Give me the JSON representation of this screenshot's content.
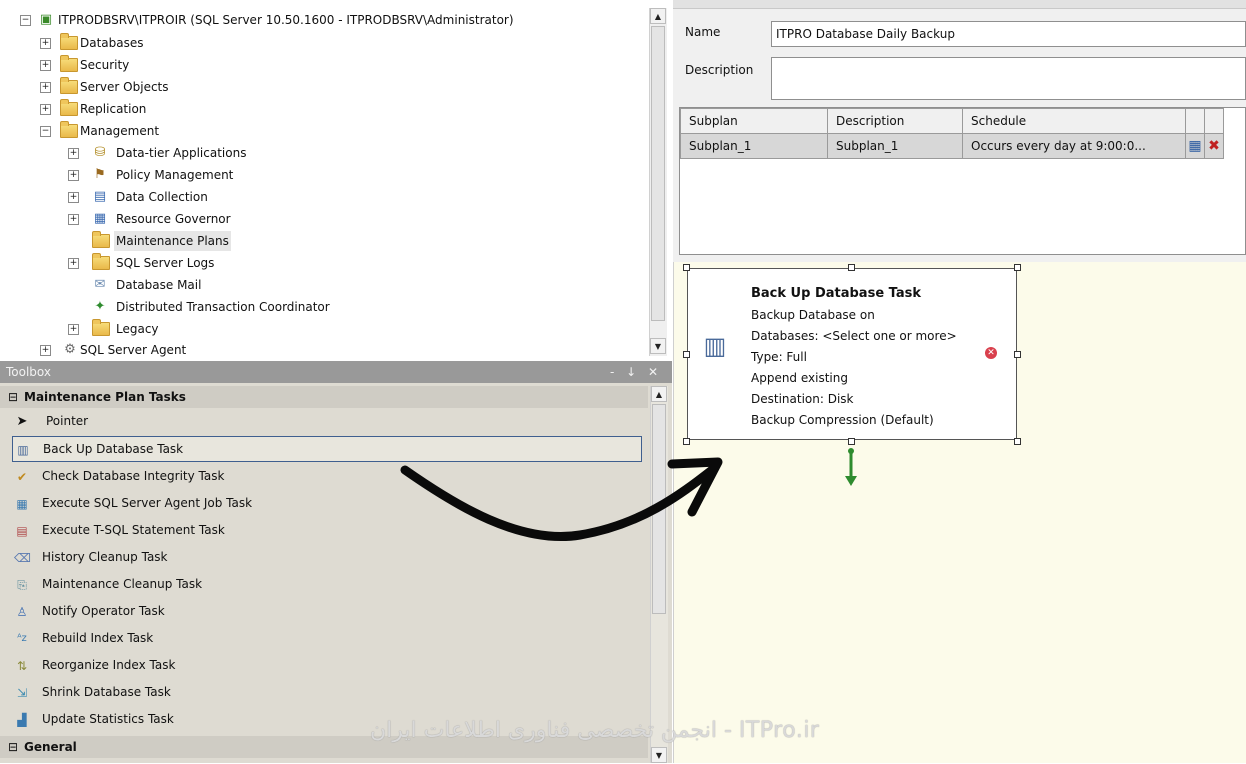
{
  "explorer": {
    "server_label": "ITPRODBSRV\\ITPROIR (SQL Server 10.50.1600 - ITPRODBSRV\\Administrator)",
    "items": [
      {
        "label": "Databases"
      },
      {
        "label": "Security"
      },
      {
        "label": "Server Objects"
      },
      {
        "label": "Replication"
      },
      {
        "label": "Management"
      },
      {
        "label": "Data-tier Applications"
      },
      {
        "label": "Policy Management"
      },
      {
        "label": "Data Collection"
      },
      {
        "label": "Resource Governor"
      },
      {
        "label": "Maintenance Plans"
      },
      {
        "label": "SQL Server Logs"
      },
      {
        "label": "Database Mail"
      },
      {
        "label": "Distributed Transaction Coordinator"
      },
      {
        "label": "Legacy"
      },
      {
        "label": "SQL Server Agent"
      }
    ]
  },
  "toolbox": {
    "title": "Toolbox",
    "title_controls": "- ↓ ✕",
    "group_maintenance": "Maintenance Plan Tasks",
    "group_general": "General",
    "items": [
      {
        "label": "Pointer"
      },
      {
        "label": "Back Up Database Task"
      },
      {
        "label": "Check Database Integrity Task"
      },
      {
        "label": "Execute SQL Server Agent Job Task"
      },
      {
        "label": "Execute T-SQL Statement Task"
      },
      {
        "label": "History Cleanup Task"
      },
      {
        "label": "Maintenance Cleanup Task"
      },
      {
        "label": "Notify Operator Task"
      },
      {
        "label": "Rebuild Index Task"
      },
      {
        "label": "Reorganize Index Task"
      },
      {
        "label": "Shrink Database Task"
      },
      {
        "label": "Update Statistics Task"
      }
    ]
  },
  "plan": {
    "name_label": "Name",
    "name_value": "ITPRO Database Daily Backup",
    "description_label": "Description",
    "description_value": "",
    "grid": {
      "headers": [
        "Subplan",
        "Description",
        "Schedule"
      ],
      "rows": [
        [
          "Subplan_1",
          "Subplan_1",
          "Occurs every day at 9:00:0..."
        ]
      ]
    }
  },
  "task": {
    "title": "Back Up Database Task",
    "lines": [
      "Backup Database on",
      "Databases: <Select one or more>",
      "Type: Full",
      "Append existing",
      "Destination: Disk",
      "Backup Compression (Default)"
    ]
  },
  "watermark": {
    "text": "انجمن تخصصی فناوری اطلاعات ایران - ITPro.ir"
  },
  "colors": {
    "canvas": "#fcfbea",
    "toolbox_bg": "#dedbd2",
    "selection_border": "#3f5f8f",
    "error_icon": "#d9404d",
    "connector_arrow": "#2e8b2e"
  }
}
